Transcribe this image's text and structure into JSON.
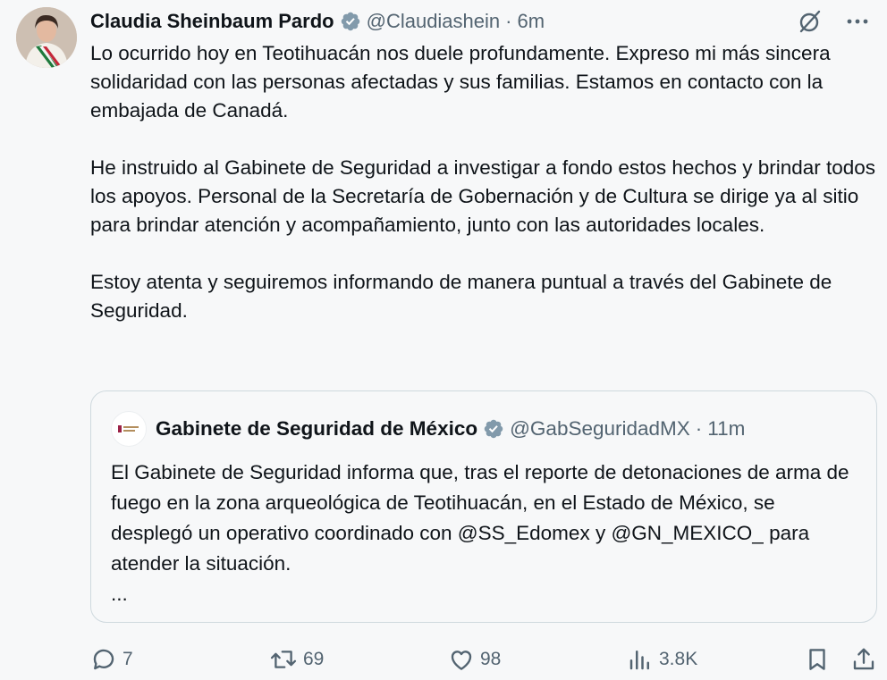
{
  "tweet": {
    "author_name": "Claudia Sheinbaum Pardo",
    "handle": "@Claudiashein",
    "separator": "·",
    "time": "6m",
    "paragraphs": [
      "Lo ocurrido hoy en Teotihuacán nos duele profundamente. Expreso mi más sincera solidaridad con las personas afectadas y sus familias. Estamos en contacto con la embajada de Canadá.",
      "He instruido al Gabinete de Seguridad a investigar a fondo estos hechos y brindar todos los apoyos. Personal de la Secretaría de Gobernación y de Cultura se dirige ya al sitio para brindar atención y acompañamiento, junto con las autoridades locales.",
      "Estoy atenta y seguiremos informando de manera puntual a través del Gabinete de Seguridad."
    ]
  },
  "quote": {
    "author_name": "Gabinete de Seguridad de México",
    "handle": "@GabSeguridadMX",
    "separator": "·",
    "time": "11m",
    "text": "El Gabinete de Seguridad informa que, tras el reporte de detonaciones de arma de fuego en la zona arqueológica de Teotihuacán, en el Estado de México, se desplegó un operativo coordinado con @SS_Edomex y @GN_MEXICO_ para atender la situación.",
    "ellipsis": "..."
  },
  "actions": {
    "replies": "7",
    "reposts": "69",
    "likes": "98",
    "views": "3.8K"
  },
  "colors": {
    "verified": "#829aab",
    "text": "#0f1419",
    "secondary": "#536471",
    "border": "#cfd9de"
  },
  "icons": [
    "verified-icon",
    "grok-icon",
    "more-icon",
    "reply-icon",
    "repost-icon",
    "like-icon",
    "views-icon",
    "bookmark-icon",
    "share-icon"
  ]
}
